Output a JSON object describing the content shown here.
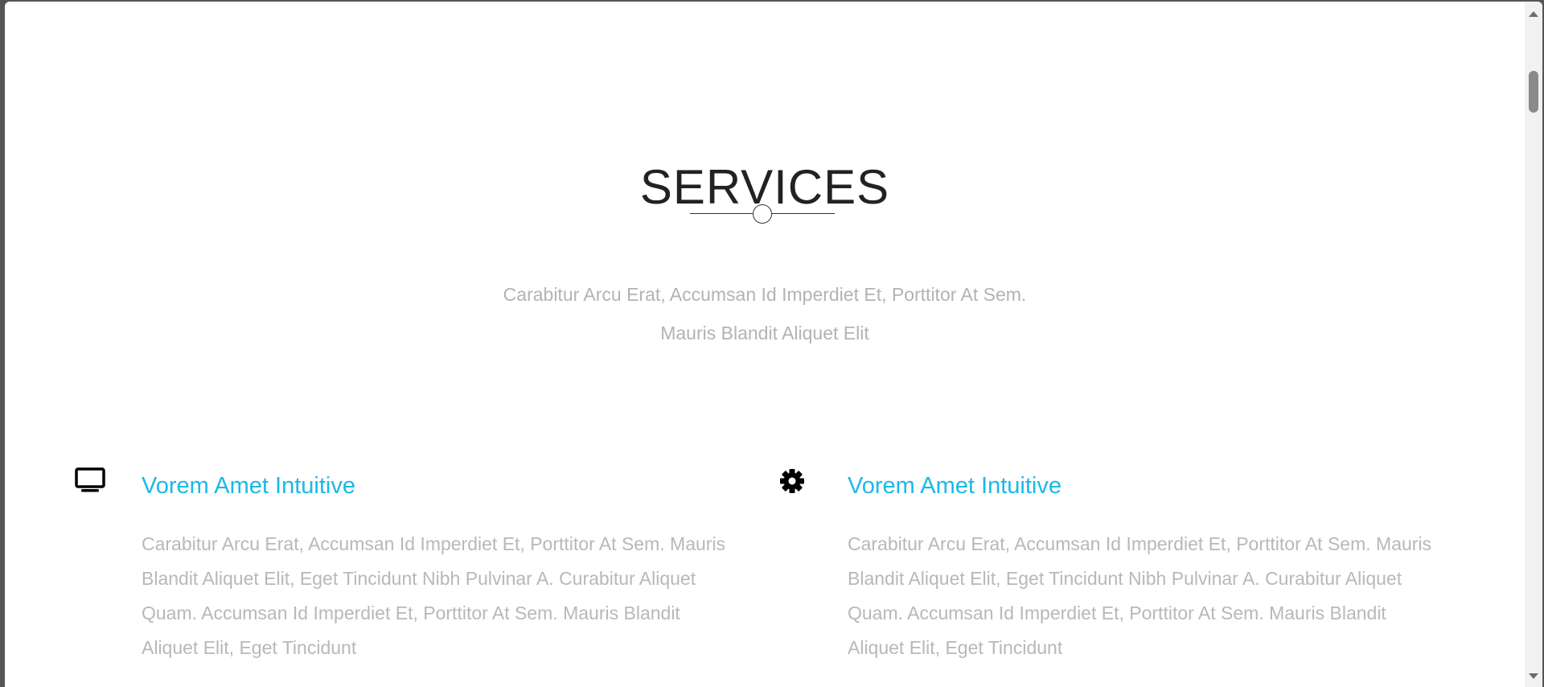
{
  "services_section": {
    "title": "SERVICES",
    "lead_line_1": "Carabitur Arcu Erat, Accumsan Id Imperdiet Et, Porttitor At Sem.",
    "lead_line_2": "Mauris Blandit Aliquet Elit",
    "items": [
      {
        "icon": "tv-icon",
        "title": "Vorem Amet Intuitive",
        "text": "Carabitur Arcu Erat, Accumsan Id Imperdiet Et, Porttitor At Sem. Mauris Blandit Aliquet Elit, Eget Tincidunt Nibh Pulvinar A. Curabitur Aliquet Quam. Accumsan Id Imperdiet Et, Porttitor At Sem. Mauris Blandit Aliquet Elit, Eget Tincidunt"
      },
      {
        "icon": "gear-icon",
        "title": "Vorem Amet Intuitive",
        "text": "Carabitur Arcu Erat, Accumsan Id Imperdiet Et, Porttitor At Sem. Mauris Blandit Aliquet Elit, Eget Tincidunt Nibh Pulvinar A. Curabitur Aliquet Quam. Accumsan Id Imperdiet Et, Porttitor At Sem. Mauris Blandit Aliquet Elit, Eget Tincidunt"
      }
    ]
  },
  "colors": {
    "accent": "#1bb8e8",
    "muted_text": "#b8b8b8",
    "heading": "#222222"
  }
}
